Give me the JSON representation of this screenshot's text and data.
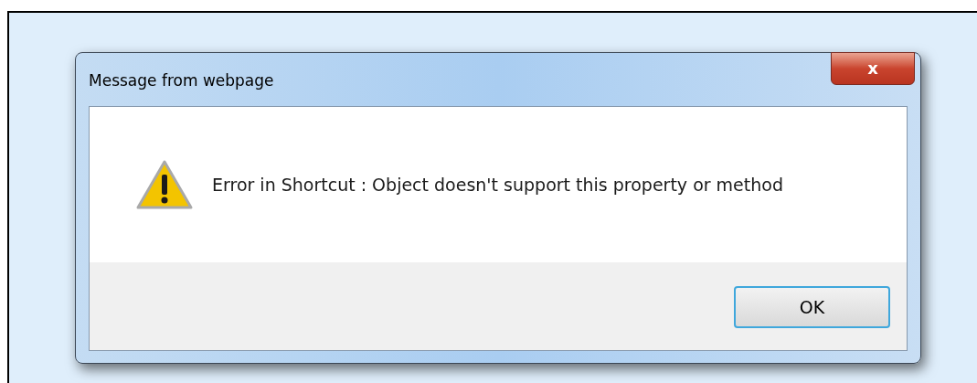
{
  "window": {
    "title": "Message from webpage",
    "close_label": "x"
  },
  "message": "Error in Shortcut : Object doesn't support this property or method",
  "buttons": [
    {
      "label": "OK",
      "focused": true
    }
  ]
}
